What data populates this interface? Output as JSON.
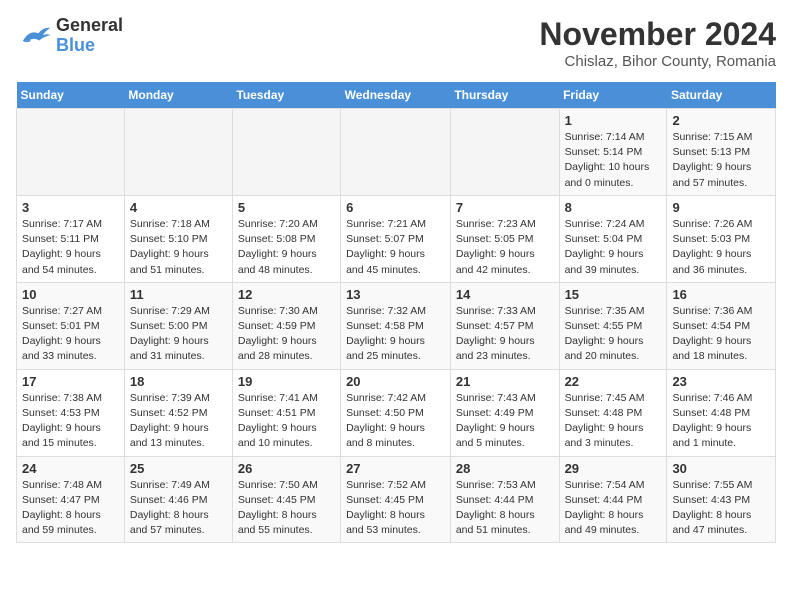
{
  "header": {
    "logo_line1": "General",
    "logo_line2": "Blue",
    "month_title": "November 2024",
    "location": "Chislaz, Bihor County, Romania"
  },
  "weekdays": [
    "Sunday",
    "Monday",
    "Tuesday",
    "Wednesday",
    "Thursday",
    "Friday",
    "Saturday"
  ],
  "weeks": [
    [
      {
        "day": "",
        "info": ""
      },
      {
        "day": "",
        "info": ""
      },
      {
        "day": "",
        "info": ""
      },
      {
        "day": "",
        "info": ""
      },
      {
        "day": "",
        "info": ""
      },
      {
        "day": "1",
        "info": "Sunrise: 7:14 AM\nSunset: 5:14 PM\nDaylight: 10 hours\nand 0 minutes."
      },
      {
        "day": "2",
        "info": "Sunrise: 7:15 AM\nSunset: 5:13 PM\nDaylight: 9 hours\nand 57 minutes."
      }
    ],
    [
      {
        "day": "3",
        "info": "Sunrise: 7:17 AM\nSunset: 5:11 PM\nDaylight: 9 hours\nand 54 minutes."
      },
      {
        "day": "4",
        "info": "Sunrise: 7:18 AM\nSunset: 5:10 PM\nDaylight: 9 hours\nand 51 minutes."
      },
      {
        "day": "5",
        "info": "Sunrise: 7:20 AM\nSunset: 5:08 PM\nDaylight: 9 hours\nand 48 minutes."
      },
      {
        "day": "6",
        "info": "Sunrise: 7:21 AM\nSunset: 5:07 PM\nDaylight: 9 hours\nand 45 minutes."
      },
      {
        "day": "7",
        "info": "Sunrise: 7:23 AM\nSunset: 5:05 PM\nDaylight: 9 hours\nand 42 minutes."
      },
      {
        "day": "8",
        "info": "Sunrise: 7:24 AM\nSunset: 5:04 PM\nDaylight: 9 hours\nand 39 minutes."
      },
      {
        "day": "9",
        "info": "Sunrise: 7:26 AM\nSunset: 5:03 PM\nDaylight: 9 hours\nand 36 minutes."
      }
    ],
    [
      {
        "day": "10",
        "info": "Sunrise: 7:27 AM\nSunset: 5:01 PM\nDaylight: 9 hours\nand 33 minutes."
      },
      {
        "day": "11",
        "info": "Sunrise: 7:29 AM\nSunset: 5:00 PM\nDaylight: 9 hours\nand 31 minutes."
      },
      {
        "day": "12",
        "info": "Sunrise: 7:30 AM\nSunset: 4:59 PM\nDaylight: 9 hours\nand 28 minutes."
      },
      {
        "day": "13",
        "info": "Sunrise: 7:32 AM\nSunset: 4:58 PM\nDaylight: 9 hours\nand 25 minutes."
      },
      {
        "day": "14",
        "info": "Sunrise: 7:33 AM\nSunset: 4:57 PM\nDaylight: 9 hours\nand 23 minutes."
      },
      {
        "day": "15",
        "info": "Sunrise: 7:35 AM\nSunset: 4:55 PM\nDaylight: 9 hours\nand 20 minutes."
      },
      {
        "day": "16",
        "info": "Sunrise: 7:36 AM\nSunset: 4:54 PM\nDaylight: 9 hours\nand 18 minutes."
      }
    ],
    [
      {
        "day": "17",
        "info": "Sunrise: 7:38 AM\nSunset: 4:53 PM\nDaylight: 9 hours\nand 15 minutes."
      },
      {
        "day": "18",
        "info": "Sunrise: 7:39 AM\nSunset: 4:52 PM\nDaylight: 9 hours\nand 13 minutes."
      },
      {
        "day": "19",
        "info": "Sunrise: 7:41 AM\nSunset: 4:51 PM\nDaylight: 9 hours\nand 10 minutes."
      },
      {
        "day": "20",
        "info": "Sunrise: 7:42 AM\nSunset: 4:50 PM\nDaylight: 9 hours\nand 8 minutes."
      },
      {
        "day": "21",
        "info": "Sunrise: 7:43 AM\nSunset: 4:49 PM\nDaylight: 9 hours\nand 5 minutes."
      },
      {
        "day": "22",
        "info": "Sunrise: 7:45 AM\nSunset: 4:48 PM\nDaylight: 9 hours\nand 3 minutes."
      },
      {
        "day": "23",
        "info": "Sunrise: 7:46 AM\nSunset: 4:48 PM\nDaylight: 9 hours\nand 1 minute."
      }
    ],
    [
      {
        "day": "24",
        "info": "Sunrise: 7:48 AM\nSunset: 4:47 PM\nDaylight: 8 hours\nand 59 minutes."
      },
      {
        "day": "25",
        "info": "Sunrise: 7:49 AM\nSunset: 4:46 PM\nDaylight: 8 hours\nand 57 minutes."
      },
      {
        "day": "26",
        "info": "Sunrise: 7:50 AM\nSunset: 4:45 PM\nDaylight: 8 hours\nand 55 minutes."
      },
      {
        "day": "27",
        "info": "Sunrise: 7:52 AM\nSunset: 4:45 PM\nDaylight: 8 hours\nand 53 minutes."
      },
      {
        "day": "28",
        "info": "Sunrise: 7:53 AM\nSunset: 4:44 PM\nDaylight: 8 hours\nand 51 minutes."
      },
      {
        "day": "29",
        "info": "Sunrise: 7:54 AM\nSunset: 4:44 PM\nDaylight: 8 hours\nand 49 minutes."
      },
      {
        "day": "30",
        "info": "Sunrise: 7:55 AM\nSunset: 4:43 PM\nDaylight: 8 hours\nand 47 minutes."
      }
    ]
  ]
}
